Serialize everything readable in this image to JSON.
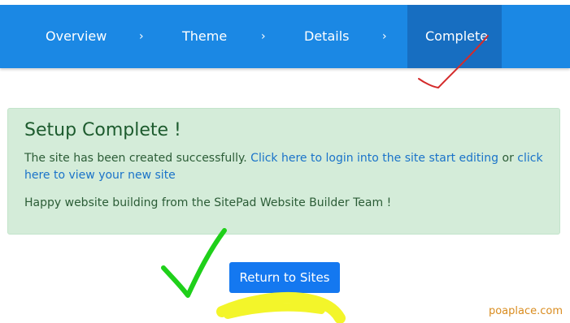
{
  "stepper": {
    "steps": [
      {
        "label": "Overview"
      },
      {
        "label": "Theme"
      },
      {
        "label": "Details"
      },
      {
        "label": "Complete",
        "active": true
      }
    ],
    "separator": "›",
    "bg_color": "#1b88e4",
    "active_color": "#176ec1"
  },
  "alert": {
    "title": "Setup Complete !",
    "text_before": "The site has been created successfully.",
    "link_login": "Click here to login into the site start editing",
    "text_or": "or",
    "link_view": "click here to view your new site",
    "footer": "Happy website building from the SitePad Website Builder Team !",
    "bg_color": "#d4ecd9"
  },
  "button": {
    "label": "Return to Sites",
    "color": "#1478f0"
  },
  "watermark": {
    "text": "poaplace.com"
  },
  "annotations": {
    "red_check": "checkmark-scribble",
    "green_check": "checkmark-scribble",
    "yellow_highlight": "highlight-stroke"
  }
}
